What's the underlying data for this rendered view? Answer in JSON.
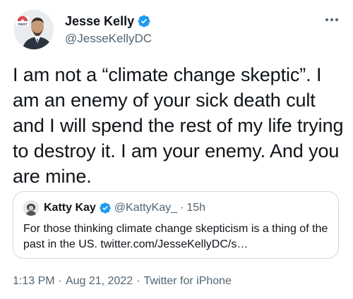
{
  "author": {
    "display_name": "Jesse Kelly",
    "handle": "@JesseKellyDC",
    "avatar_logo_text": "FIRST",
    "verified": true
  },
  "tweet": {
    "text": "I am not a “climate change skeptic”. I am an enemy of your sick death cult and I will spend the rest of my life trying to destroy it. I am your enemy. And you are mine."
  },
  "quote": {
    "display_name": "Katty Kay",
    "handle": "@KattyKay_",
    "separator": "·",
    "time": "15h",
    "text": "For those thinking climate change skepticism is a thing of the past in the US. twitter.com/JesseKellyDC/s…",
    "verified": true
  },
  "meta": {
    "time": "1:13 PM",
    "sep1": "·",
    "date": "Aug 21, 2022",
    "sep2": "·",
    "source": "Twitter for iPhone"
  },
  "colors": {
    "verified_blue": "#1d9bf0",
    "text_primary": "#0f1419",
    "text_secondary": "#536471",
    "border": "#cfd9de"
  },
  "icons": {
    "more": "more-horizontal-icon",
    "verified": "verified-badge-icon"
  }
}
